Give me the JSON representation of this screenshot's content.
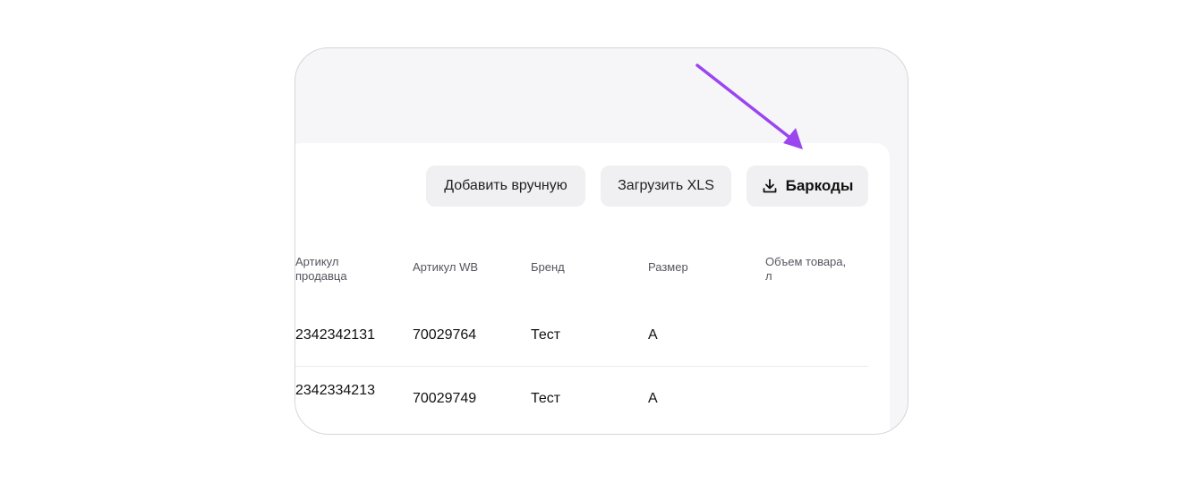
{
  "toolbar": {
    "add_manual_label": "Добавить вручную",
    "upload_xls_label": "Загрузить XLS",
    "barcodes_label": "Баркоды",
    "barcodes_icon": "download-icon"
  },
  "table": {
    "columns": [
      "Артикул продавца",
      "Артикул WB",
      "Бренд",
      "Размер",
      "Объем товара, л"
    ],
    "rows": [
      {
        "seller_article": "2342342131",
        "wb_article": "70029764",
        "brand": "Тест",
        "size": "A",
        "volume": ""
      },
      {
        "seller_article": "2342334213",
        "wb_article": "70029749",
        "brand": "Тест",
        "size": "A",
        "volume": ""
      }
    ]
  },
  "annotation": {
    "arrow_color": "#9b45f0"
  }
}
